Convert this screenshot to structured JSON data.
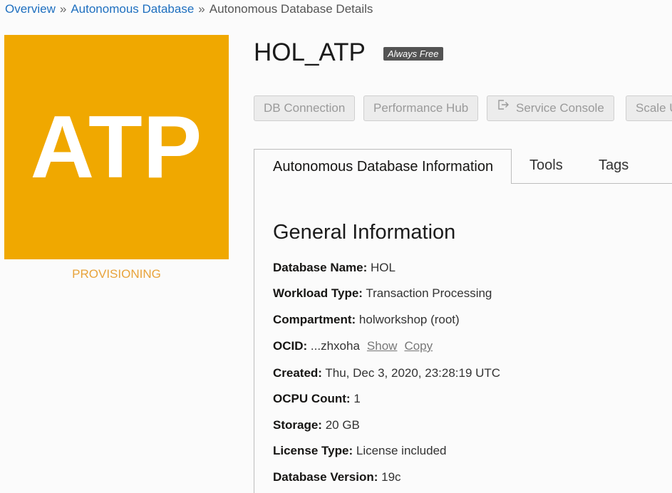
{
  "breadcrumb": {
    "overview": "Overview",
    "sep1": "»",
    "autonomous_database": "Autonomous Database",
    "sep2": "»",
    "current": "Autonomous Database Details"
  },
  "logo": {
    "text": "ATP",
    "color": "#f0a800"
  },
  "status": {
    "text": "PROVISIONING",
    "color": "#e8a33a"
  },
  "header": {
    "title": "HOL_ATP",
    "badge": "Always Free"
  },
  "actions": {
    "db_connection": "DB Connection",
    "performance_hub": "Performance Hub",
    "service_console": "Service Console",
    "service_console_icon": "external-link-icon",
    "scale": "Scale U"
  },
  "tabs": {
    "info": "Autonomous Database Information",
    "tools": "Tools",
    "tags": "Tags"
  },
  "general": {
    "title": "General Information",
    "database_name": {
      "label": "Database Name:",
      "value": "HOL"
    },
    "workload_type": {
      "label": "Workload Type:",
      "value": "Transaction Processing"
    },
    "compartment": {
      "label": "Compartment:",
      "value": "holworkshop (root)"
    },
    "ocid": {
      "label": "OCID:",
      "value": "...zhxoha",
      "show": "Show",
      "copy": "Copy"
    },
    "created": {
      "label": "Created:",
      "value": "Thu, Dec 3, 2020, 23:28:19 UTC"
    },
    "ocpu_count": {
      "label": "OCPU Count:",
      "value": "1"
    },
    "storage": {
      "label": "Storage:",
      "value": "20 GB"
    },
    "license_type": {
      "label": "License Type:",
      "value": "License included"
    },
    "database_version": {
      "label": "Database Version:",
      "value": "19c"
    }
  }
}
